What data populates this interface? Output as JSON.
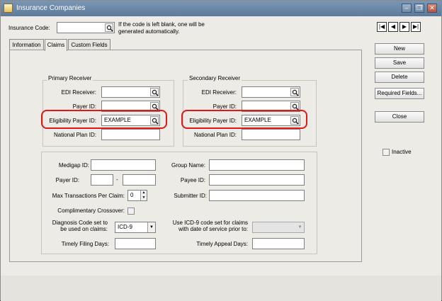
{
  "window": {
    "title": "Insurance Companies"
  },
  "header": {
    "code_label": "Insurance Code:",
    "code_value": "",
    "hint": "If the code is left blank, one will be generated automatically."
  },
  "nav": {
    "first": "|◀",
    "prev": "◀",
    "next": "▶",
    "last": "▶|"
  },
  "buttons": {
    "new": "New",
    "save": "Save",
    "delete": "Delete",
    "required_fields": "Required Fields...",
    "close": "Close"
  },
  "inactive": {
    "label": "Inactive",
    "checked": false
  },
  "tabs": [
    {
      "label": "Information",
      "active": false
    },
    {
      "label": "Claims",
      "active": true
    },
    {
      "label": "Custom Fields",
      "active": false
    }
  ],
  "primary": {
    "title": "Primary Receiver",
    "edi_label": "EDI Receiver:",
    "edi_value": "",
    "payer_label": "Payer ID:",
    "payer_value": "",
    "eligibility_label": "Eligibility Payer ID:",
    "eligibility_value": "EXAMPLE",
    "national_label": "National Plan ID:",
    "national_value": ""
  },
  "secondary": {
    "title": "Secondary Receiver",
    "edi_label": "EDI Receiver:",
    "edi_value": "",
    "payer_label": "Payer ID:",
    "payer_value": "",
    "eligibility_label": "Eligibility Payer ID:",
    "eligibility_value": "EXAMPLE",
    "national_label": "National Plan ID:",
    "national_value": ""
  },
  "claims": {
    "medigap_label": "Medigap ID:",
    "medigap_value": "",
    "payer_label": "Payer ID:",
    "payer_value_1": "",
    "payer_sep": "-",
    "payer_value_2": "",
    "max_tx_label": "Max Transactions Per Claim:",
    "max_tx_value": "0",
    "comp_label": "Complimentary Crossover:",
    "comp_checked": false,
    "diag_label_1": "Diagnosis Code set to",
    "diag_label_2": "be used on claims:",
    "diag_value": "ICD-9",
    "timely_filing_label": "Timely Filing Days:",
    "timely_filing_value": "",
    "group_label": "Group Name:",
    "group_value": "",
    "payee_label": "Payee ID:",
    "payee_value": "",
    "submitter_label": "Submitter ID:",
    "submitter_value": "",
    "icd9_label_1": "Use ICD-9 code set for claims",
    "icd9_label_2": "with date of service prior to:",
    "icd9_value": "",
    "timely_appeal_label": "Timely Appeal Days:",
    "timely_appeal_value": ""
  },
  "colors": {
    "highlight": "#e01818",
    "titlebar": "#6a86a6"
  },
  "icons": [
    "lookup-magnifier-icon",
    "window-icon",
    "minimize-icon",
    "restore-icon",
    "close-icon"
  ]
}
